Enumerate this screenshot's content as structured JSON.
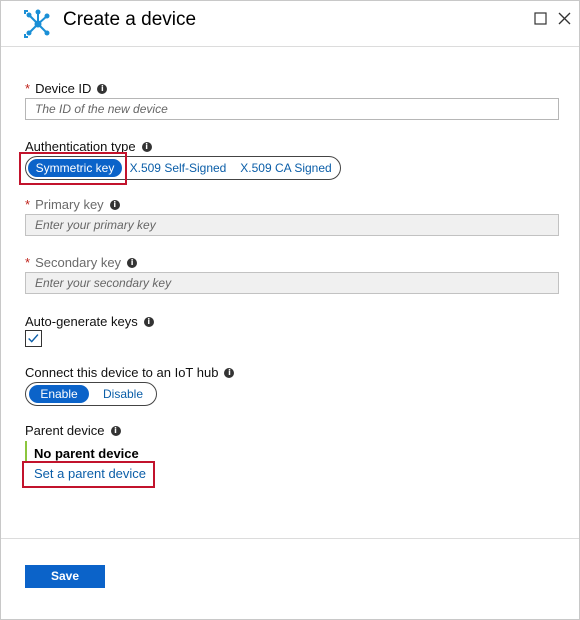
{
  "header": {
    "title": "Create a device",
    "icon": "iot-hub-icon",
    "window_buttons": [
      "maximize-icon",
      "close-icon"
    ]
  },
  "form": {
    "device_id": {
      "label": "Device ID",
      "required": "*",
      "placeholder": "The ID of the new device"
    },
    "auth_type": {
      "label": "Authentication type",
      "options": [
        "Symmetric key",
        "X.509 Self-Signed",
        "X.509 CA Signed"
      ],
      "selected": "Symmetric key"
    },
    "primary_key": {
      "label": "Primary key",
      "required": "*",
      "placeholder": "Enter your primary key"
    },
    "secondary_key": {
      "label": "Secondary key",
      "required": "*",
      "placeholder": "Enter your secondary key"
    },
    "auto_generate": {
      "label": "Auto-generate keys",
      "checked": true
    },
    "connect_hub": {
      "label": "Connect this device to an IoT hub",
      "options": [
        "Enable",
        "Disable"
      ],
      "selected": "Enable"
    },
    "parent_device": {
      "label": "Parent device",
      "value": "No parent device",
      "link": "Set a parent device"
    }
  },
  "footer": {
    "save_label": "Save"
  },
  "colors": {
    "accent": "#0b63c9",
    "link": "#0b5ea8",
    "required": "#c0231b",
    "highlight": "#c2132c",
    "parent_bar": "#8cc63e"
  }
}
